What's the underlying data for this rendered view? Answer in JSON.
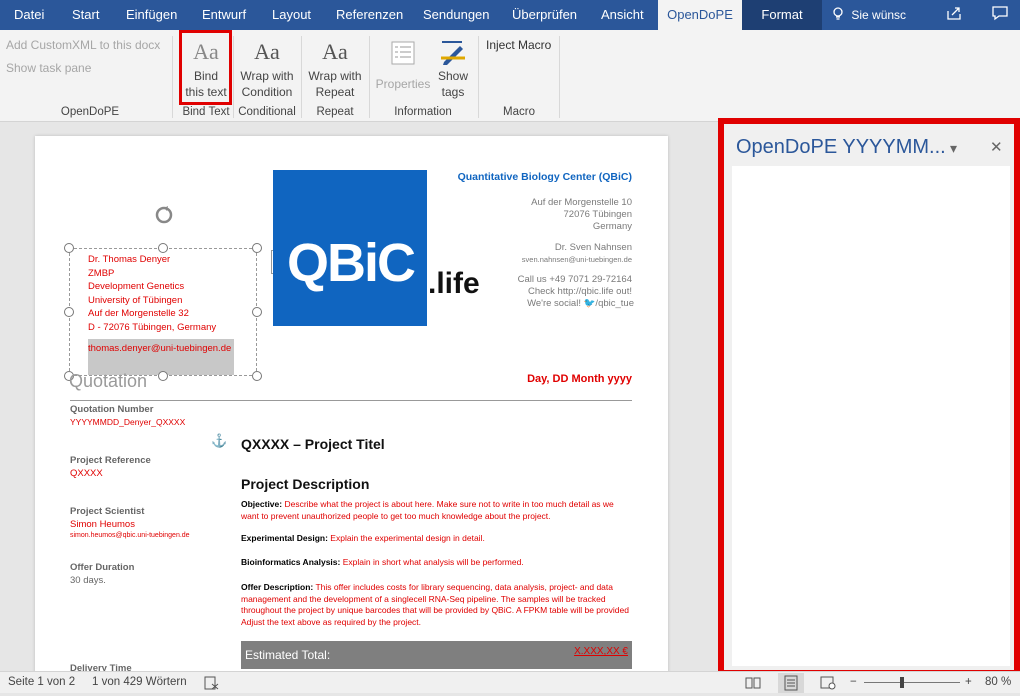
{
  "tabs": [
    {
      "label": "Datei"
    },
    {
      "label": "Start"
    },
    {
      "label": "Einfügen"
    },
    {
      "label": "Entwurf"
    },
    {
      "label": "Layout"
    },
    {
      "label": "Referenzen"
    },
    {
      "label": "Sendungen"
    },
    {
      "label": "Überprüfen"
    },
    {
      "label": "Ansicht"
    },
    {
      "label": "OpenDoPE"
    },
    {
      "label": "Format"
    }
  ],
  "tellme": "Sie wünsc",
  "ribbon": {
    "add_customxml": "Add CustomXML to this docx",
    "show_taskpane": "Show task pane",
    "group_opendope": "OpenDoPE",
    "bind_label1": "Bind",
    "bind_label2": "this text",
    "group_bind": "Bind Text",
    "wrap_cond1": "Wrap with",
    "wrap_cond2": "Condition",
    "group_cond": "Conditional",
    "wrap_rep1": "Wrap with",
    "wrap_rep2": "Repeat",
    "group_repeat": "Repeat",
    "properties": "Properties",
    "show1": "Show",
    "show2": "tags",
    "group_info": "Information",
    "inject_macro": "Inject Macro",
    "group_macro": "Macro",
    "aa": "Aa"
  },
  "doc": {
    "address": [
      "Dr. Thomas Denyer",
      "ZMBP",
      "Development Genetics",
      "University of Tübingen",
      "Auf der Morgenstelle 32",
      "D - 72076 Tübingen, Germany"
    ],
    "email": "thomas.denyer@uni-tuebingen.de",
    "quotation": "Quotation",
    "logo": "QBiC",
    "life": ".life",
    "org": "Quantitative Biology Center (QBiC)",
    "org_addr": [
      "Auf der Morgenstelle 10",
      "72076 Tübingen",
      "Germany"
    ],
    "contact_name": "Dr. Sven Nahnsen",
    "contact_mail": "sven.nahnsen@uni-tuebingen.de",
    "contact_lines": [
      "Call us +49 7071 29-72164",
      "Check http://qbic.life out!",
      "We're social! 🐦/qbic_tue"
    ],
    "date": "Day, DD Month yyyy",
    "qn_label": "Quotation Number",
    "qn_val": "YYYYMMDD_Denyer_QXXXX",
    "pr_label": "Project Reference",
    "pr_val": "QXXXX",
    "ps_label": "Project Scientist",
    "ps_val": "Simon Heumos",
    "ps_mail": "simon.heumos@qbic.uni-tuebingen.de",
    "od_label": "Offer Duration",
    "od_val": "30 days.",
    "dt_label": "Delivery Time",
    "project_title": "QXXXX – Project Titel",
    "desc_head": "Project Description",
    "objective_label": "Objective:",
    "objective": "Describe what the project is about here. Make sure not to write in too much detail as we want to prevent unauthorized people to get too much knowledge about the project.",
    "exp_label": "Experimental Design:",
    "exp": "Explain the experimental design in detail.",
    "bio_label": "Bioinformatics Analysis:",
    "bio": "Explain in short what analysis will be performed.",
    "offer_label": "Offer Description:",
    "offer": "This offer includes costs for library sequencing, data analysis, project- and data management and the development of a singlecell RNA-Seq pipeline. The samples will be tracked throughout the project by unique barcodes that will be provided by QBiC. A FPKM table will be provided              Adjust the text above as required by the project.",
    "total_label": "Estimated Total:",
    "total_val": "X.XXX,XX €"
  },
  "pane": {
    "title": "OpenDoPE YYYYMM...",
    "dropdown": "▾",
    "close": "✕"
  },
  "status": {
    "page": "Seite 1 von 2",
    "words": "1 von 429 Wörtern",
    "zoom": "80 %",
    "minus": "−",
    "plus": "+"
  }
}
